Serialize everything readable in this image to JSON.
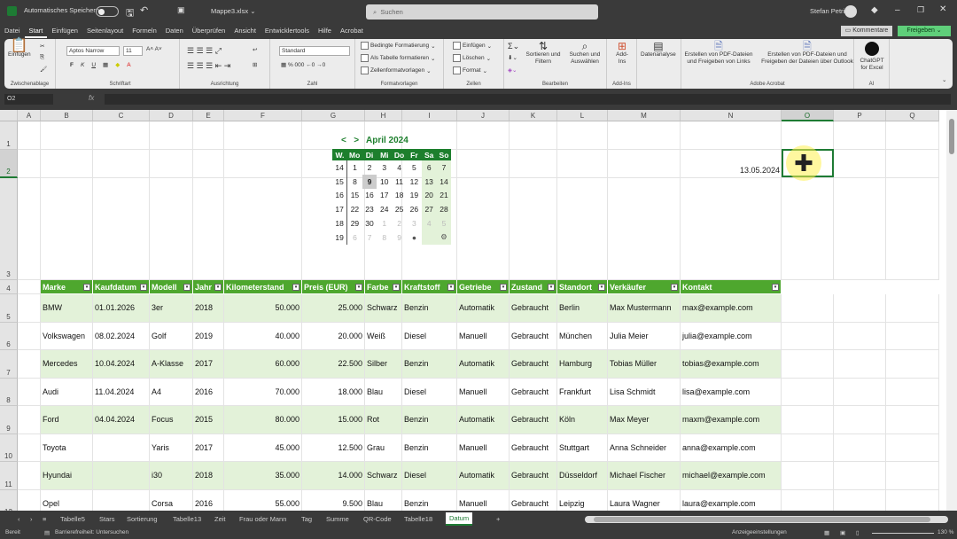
{
  "titlebar": {
    "autosave": "Automatisches Speichern",
    "filename": "Mappe3.xlsx",
    "search_placeholder": "Suchen",
    "user": "Stefan Petri"
  },
  "menus": [
    "Datei",
    "Start",
    "Einfügen",
    "Seitenlayout",
    "Formeln",
    "Daten",
    "Überprüfen",
    "Ansicht",
    "Entwicklertools",
    "Hilfe",
    "Acrobat"
  ],
  "active_menu": "Start",
  "buttons": {
    "comments": "Kommentare",
    "share": "Freigeben"
  },
  "ribbon": {
    "paste": "Einfügen",
    "font": "Aptos Narrow",
    "size": "11",
    "number_format": "Standard",
    "cond_format": "Bedingte Formatierung",
    "as_table": "Als Tabelle formatieren",
    "cell_styles": "Zellenformatvorlagen",
    "insert": "Einfügen",
    "delete": "Löschen",
    "format": "Format",
    "sort": "Sortieren und Filtern",
    "find": "Suchen und Auswählen",
    "addins": "Add-Ins",
    "analyze": "Datenanalyse",
    "pdf_links": "Erstellen von PDF-Dateien und Freigeben von Links",
    "pdf_outlook": "Erstellen von PDF-Dateien und Freigeben der Dateien über Outlook",
    "chatgpt": "ChatGPT for Excel",
    "groups": [
      "Zwischenablage",
      "Schriftart",
      "Ausrichtung",
      "Zahl",
      "Formatvorlagen",
      "Zellen",
      "Bearbeiten",
      "Add-Ins",
      "Adobe Acrobat",
      "AI"
    ]
  },
  "namebox": "O2",
  "columns": [
    "A",
    "B",
    "C",
    "D",
    "E",
    "F",
    "G",
    "H",
    "I",
    "J",
    "K",
    "L",
    "M",
    "N",
    "O",
    "P",
    "Q"
  ],
  "rows": [
    "1",
    "2",
    "3",
    "4",
    "5",
    "6",
    "7",
    "8",
    "9",
    "10",
    "11",
    "12"
  ],
  "selected_cell": "O2",
  "date_cell": "13.05.2024",
  "calendar": {
    "prev": "<",
    "next": ">",
    "month": "April 2024",
    "headers": [
      "W.",
      "Mo",
      "Di",
      "Mi",
      "Do",
      "Fr",
      "Sa",
      "So"
    ],
    "weeks": [
      [
        "14",
        "1",
        "2",
        "3",
        "4",
        "5",
        "6",
        "7"
      ],
      [
        "15",
        "8",
        "9",
        "10",
        "11",
        "12",
        "13",
        "14"
      ],
      [
        "16",
        "15",
        "16",
        "17",
        "18",
        "19",
        "20",
        "21"
      ],
      [
        "17",
        "22",
        "23",
        "24",
        "25",
        "26",
        "27",
        "28"
      ],
      [
        "18",
        "29",
        "30",
        "1",
        "2",
        "3",
        "4",
        "5"
      ],
      [
        "19",
        "6",
        "7",
        "8",
        "9",
        "",
        "",
        ""
      ]
    ],
    "today": "9"
  },
  "table": {
    "headers": [
      "Marke",
      "Kaufdatum",
      "Modell",
      "Jahr",
      "Kilometerstand",
      "Preis (EUR)",
      "Farbe",
      "Kraftstoff",
      "Getriebe",
      "Zustand",
      "Standort",
      "Verkäufer",
      "Kontakt"
    ],
    "rows": [
      [
        "BMW",
        "01.01.2026",
        "3er",
        "2018",
        "50.000",
        "25.000",
        "Schwarz",
        "Benzin",
        "Automatik",
        "Gebraucht",
        "Berlin",
        "Max Mustermann",
        "max@example.com"
      ],
      [
        "Volkswagen",
        "08.02.2024",
        "Golf",
        "2019",
        "40.000",
        "20.000",
        "Weiß",
        "Diesel",
        "Manuell",
        "Gebraucht",
        "München",
        "Julia Meier",
        "julia@example.com"
      ],
      [
        "Mercedes",
        "10.04.2024",
        "A-Klasse",
        "2017",
        "60.000",
        "22.500",
        "Silber",
        "Benzin",
        "Automatik",
        "Gebraucht",
        "Hamburg",
        "Tobias Müller",
        "tobias@example.com"
      ],
      [
        "Audi",
        "11.04.2024",
        "A4",
        "2016",
        "70.000",
        "18.000",
        "Blau",
        "Diesel",
        "Manuell",
        "Gebraucht",
        "Frankfurt",
        "Lisa Schmidt",
        "lisa@example.com"
      ],
      [
        "Ford",
        "04.04.2024",
        "Focus",
        "2015",
        "80.000",
        "15.000",
        "Rot",
        "Benzin",
        "Automatik",
        "Gebraucht",
        "Köln",
        "Max Meyer",
        "maxm@example.com"
      ],
      [
        "Toyota",
        "",
        "Yaris",
        "2017",
        "45.000",
        "12.500",
        "Grau",
        "Benzin",
        "Manuell",
        "Gebraucht",
        "Stuttgart",
        "Anna Schneider",
        "anna@example.com"
      ],
      [
        "Hyundai",
        "",
        "i30",
        "2018",
        "35.000",
        "14.000",
        "Schwarz",
        "Diesel",
        "Automatik",
        "Gebraucht",
        "Düsseldorf",
        "Michael Fischer",
        "michael@example.com"
      ],
      [
        "Opel",
        "",
        "Corsa",
        "2016",
        "55.000",
        "9.500",
        "Blau",
        "Benzin",
        "Manuell",
        "Gebraucht",
        "Leipzig",
        "Laura Wagner",
        "laura@example.com"
      ]
    ]
  },
  "sheets": [
    "Tabelle5",
    "Stars",
    "Sortierung",
    "Tabelle13",
    "Zeit",
    "Frau oder Mann",
    "Tag",
    "Summe",
    "QR-Code",
    "Tabelle18",
    "Datum"
  ],
  "active_sheet": "Datum",
  "status": {
    "ready": "Bereit",
    "accessibility": "Barrierefreiheit: Untersuchen",
    "display_settings": "Anzeigeeinstellungen",
    "zoom": "130 %"
  },
  "colors": {
    "table_header": "#4ea72e",
    "band": "#e3f2d9",
    "calendar_header": "#1d7f2d",
    "accent": "#1e7b34"
  }
}
